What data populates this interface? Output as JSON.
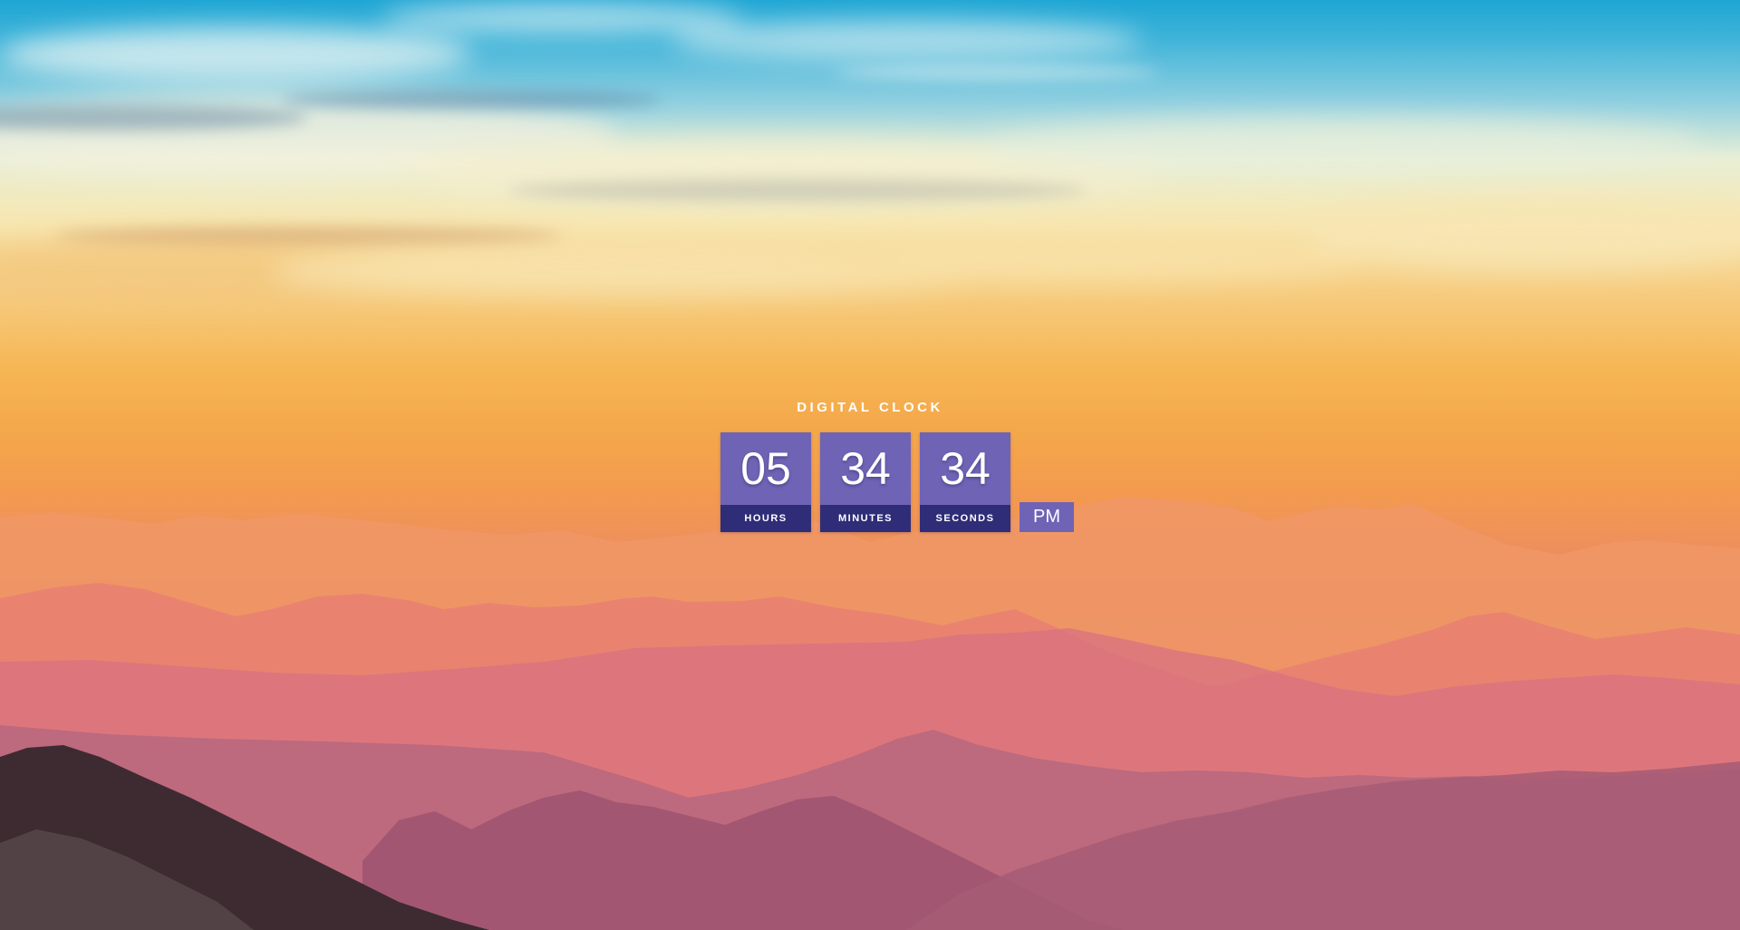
{
  "clock": {
    "title": "DIGITAL CLOCK",
    "hours": {
      "value": "05",
      "label": "HOURS"
    },
    "minutes": {
      "value": "34",
      "label": "MINUTES"
    },
    "seconds": {
      "value": "34",
      "label": "SECONDS"
    },
    "period": "PM"
  },
  "colors": {
    "tile": "#6f63b6",
    "label_band": "#2f2d77",
    "text": "#ffffff"
  }
}
